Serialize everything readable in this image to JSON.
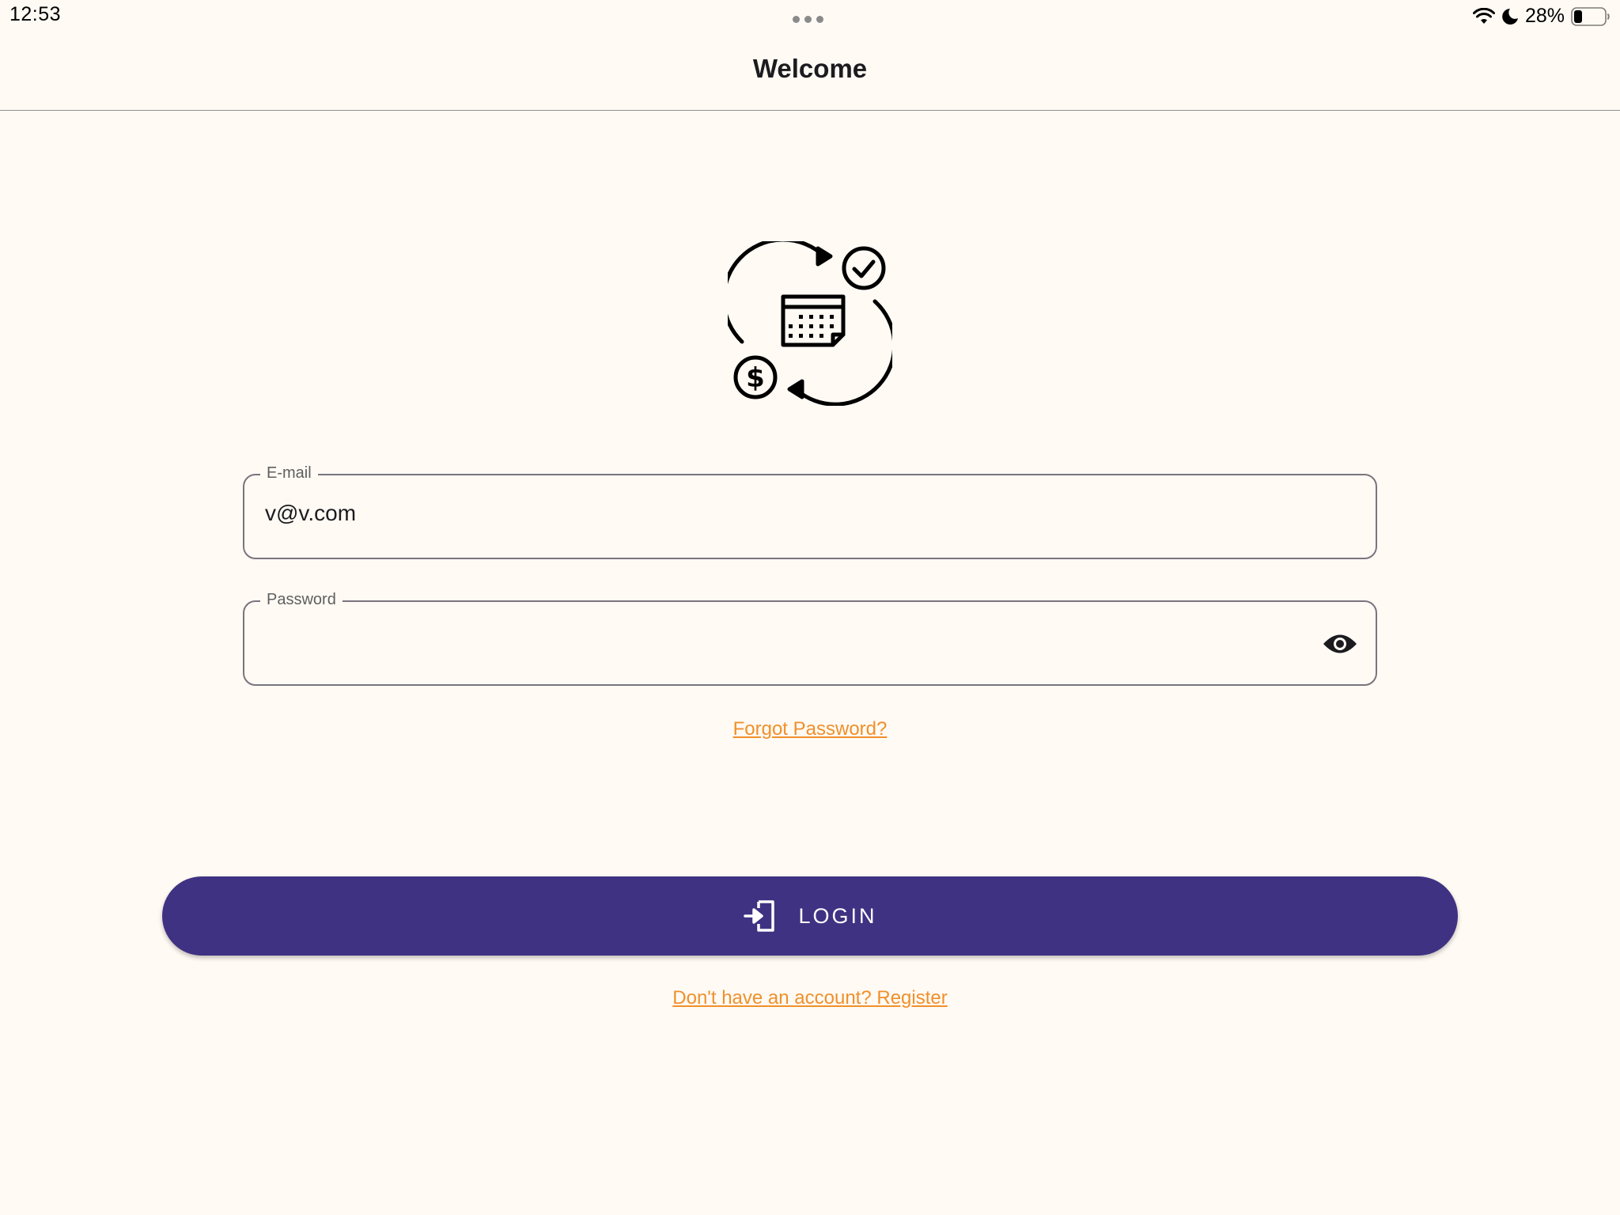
{
  "status_bar": {
    "time": "12:53",
    "battery_percent": "28%",
    "battery_level": 0.28,
    "icons": [
      "wifi-icon",
      "moon-icon",
      "battery-icon"
    ]
  },
  "app_bar": {
    "title": "Welcome"
  },
  "logo": {
    "icon": "calendar-payment-cycle-icon"
  },
  "form": {
    "email": {
      "label": "E-mail",
      "value": "v@v.com"
    },
    "password": {
      "label": "Password",
      "value": "",
      "toggle_icon": "eye-icon"
    },
    "forgot_password_link": "Forgot Password?",
    "login_button": {
      "label": "LOGIN",
      "icon": "login-icon"
    },
    "register_link": "Don't have an account? Register"
  },
  "colors": {
    "background": "#fffaf4",
    "primary": "#3f3282",
    "link": "#f0902a",
    "outline": "#79747e"
  }
}
